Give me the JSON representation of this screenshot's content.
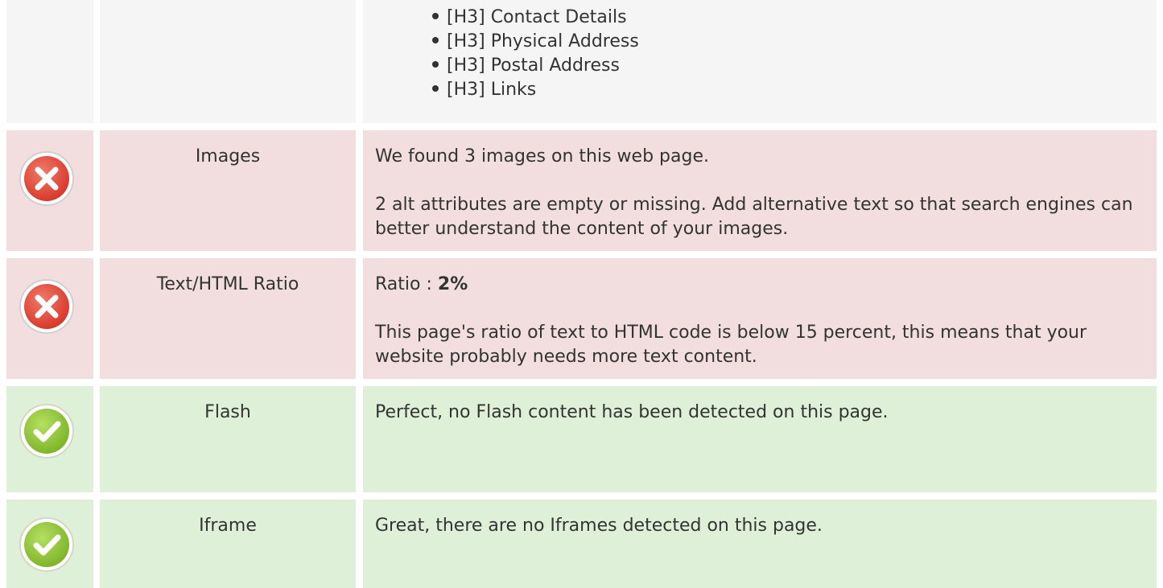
{
  "headings_continuation": {
    "items": [
      "[H3] Contact Details",
      "[H3] Physical Address",
      "[H3] Postal Address",
      "[H3] Links"
    ]
  },
  "checks": {
    "images": {
      "label": "Images",
      "status": "fail",
      "icon": "error-icon",
      "line1": "We found 3 images on this web page.",
      "line2": "2 alt attributes are empty or missing. Add alternative text so that search engines can better understand the content of your images."
    },
    "ratio": {
      "label": "Text/HTML Ratio",
      "status": "fail",
      "icon": "error-icon",
      "prefix": "Ratio : ",
      "value": "2%",
      "line2": "This page's ratio of text to HTML code is below 15 percent, this means that your website probably needs more text content."
    },
    "flash": {
      "label": "Flash",
      "status": "pass",
      "icon": "check-icon",
      "line1": "Perfect, no Flash content has been detected on this page."
    },
    "iframe": {
      "label": "Iframe",
      "status": "pass",
      "icon": "check-icon",
      "line1": "Great, there are no Iframes detected on this page."
    }
  },
  "colors": {
    "neutral_bg": "#f5f5f5",
    "fail_bg": "#f2dede",
    "pass_bg": "#dff0d8",
    "error_red": "#e74c3c",
    "success_green": "#8cc63f"
  }
}
